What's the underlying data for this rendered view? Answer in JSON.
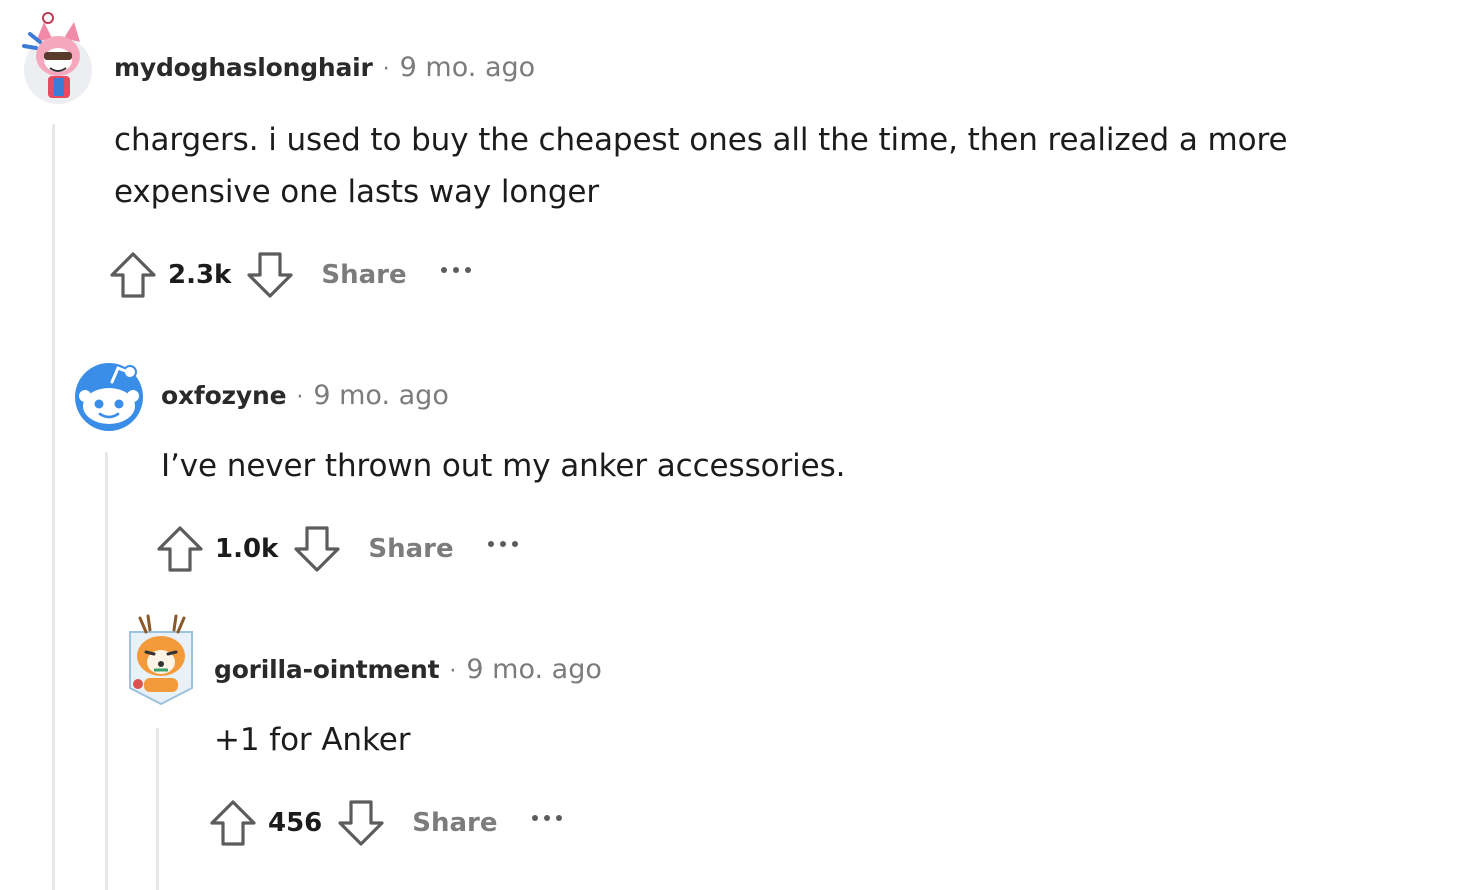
{
  "comments": [
    {
      "author": "mydoghaslonghair",
      "separator": "·",
      "time": "9 mo. ago",
      "body_lines": [
        "chargers. i used to buy the cheapest ones all the time, then realized a more",
        "expensive one lasts way longer"
      ],
      "score": "2.3k",
      "share_label": "Share",
      "avatar_icon": "pink-cat-avatar-icon"
    },
    {
      "author": "oxfozyne",
      "separator": "·",
      "time": "9 mo. ago",
      "body_lines": [
        "I’ve never thrown out my anker accessories."
      ],
      "score": "1.0k",
      "share_label": "Share",
      "avatar_icon": "snoo-default-avatar-icon"
    },
    {
      "author": "gorilla-ointment",
      "separator": "·",
      "time": "9 mo. ago",
      "body_lines": [
        "+1 for Anker"
      ],
      "score": "456",
      "share_label": "Share",
      "avatar_icon": "fox-deer-avatar-icon"
    }
  ],
  "colors": {
    "thread_line": "#e5e7ea",
    "muted_text": "#7c7c7c",
    "body_text": "#1c1c1c",
    "snoo_blue": "#3a8ee8"
  }
}
